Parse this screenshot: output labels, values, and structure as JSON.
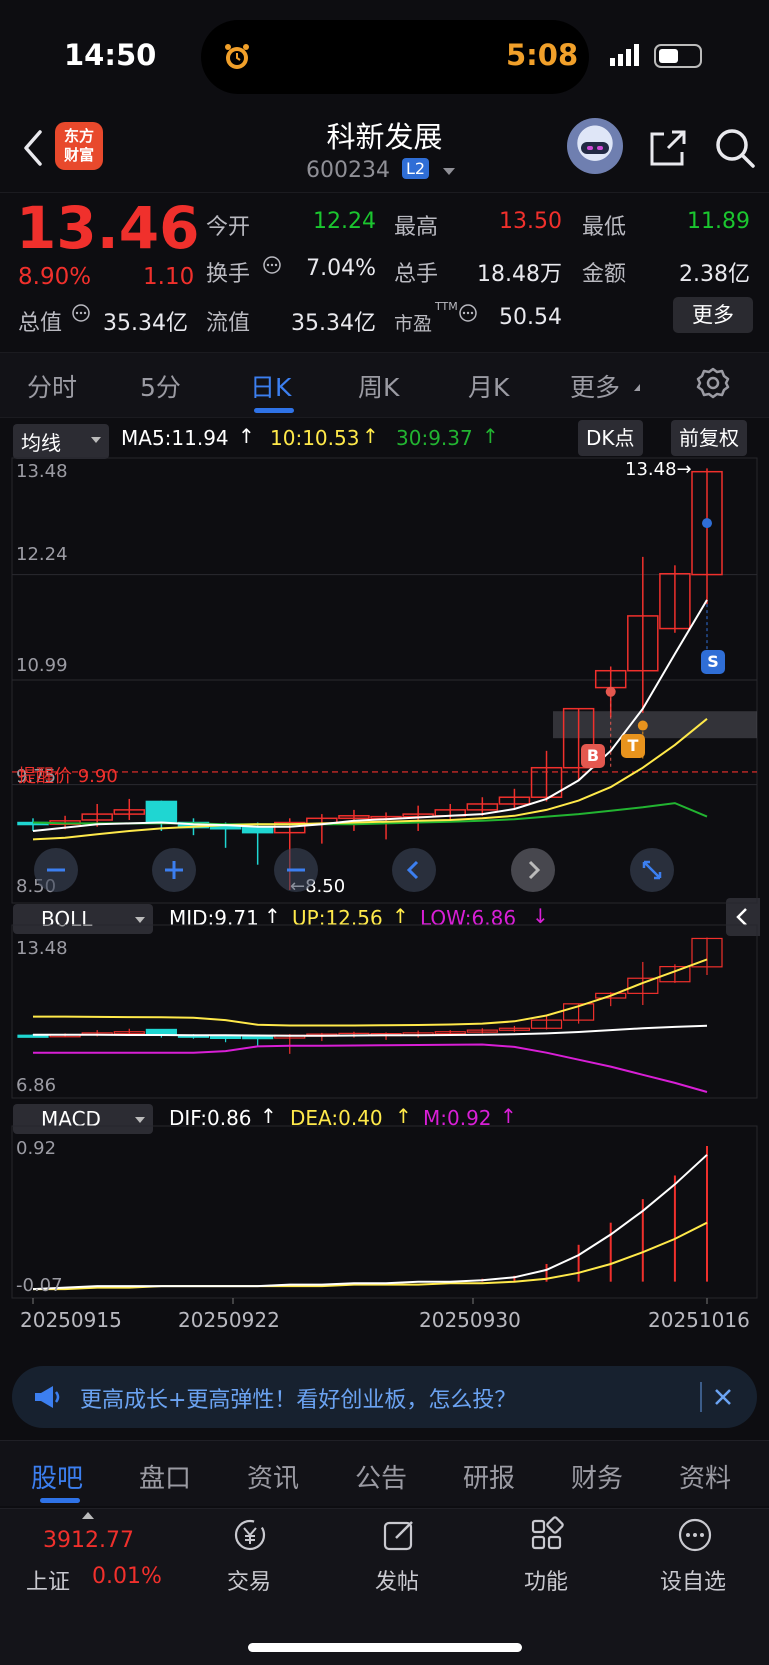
{
  "status_bar": {
    "time": "14:50",
    "timer": "5:08"
  },
  "header": {
    "logo_line1": "东方",
    "logo_line2": "财富",
    "title": "科新发展",
    "code": "600234",
    "level_badge": "L2"
  },
  "quote": {
    "price": "13.46",
    "change_pct": "8.90%",
    "change": "1.10",
    "open_label": "今开",
    "open": "12.24",
    "high_label": "最高",
    "high": "13.50",
    "low_label": "最低",
    "low": "11.89",
    "turnover_label": "换手",
    "turnover": "7.04%",
    "volume_label": "总手",
    "volume": "18.48万",
    "amount_label": "金额",
    "amount": "2.38亿",
    "mktcap_label": "总值",
    "mktcap": "35.34亿",
    "float_label": "流值",
    "float": "35.34亿",
    "pe_label": "市盈",
    "pe_sup": "TTM",
    "pe": "50.54",
    "more_button": "更多"
  },
  "tabs": [
    "分时",
    "5分",
    "日K",
    "周K",
    "月K",
    "更多"
  ],
  "active_tab": "日K",
  "main_panel": {
    "indicator": "均线",
    "ma5": "MA5:11.94",
    "ma10": "10:10.53",
    "ma30": "30:9.37",
    "dk_button": "DK点",
    "adjust_button": "前复权",
    "y_labels": [
      "13.48",
      "12.24",
      "10.99",
      "9.75",
      "8.50"
    ],
    "max_marker": "13.48→",
    "min_marker": "←8.50",
    "alert_line": "提醒价 9.90",
    "signal_b": "B",
    "signal_t": "T",
    "signal_s": "S"
  },
  "boll_panel": {
    "indicator": "BOLL",
    "mid": "MID:9.71",
    "up": "UP:12.56",
    "low": "LOW:6.86",
    "y_top": "13.48",
    "y_bottom": "6.86"
  },
  "macd_panel": {
    "indicator": "MACD",
    "dif": "DIF:0.86",
    "dea": "DEA:0.40",
    "m": "M:0.92",
    "y_top": "0.92",
    "y_bottom": "-0.07"
  },
  "dates": [
    "20250915",
    "20250922",
    "20250930",
    "20251016"
  ],
  "ad_banner": {
    "text": "更高成长+更高弹性！看好创业板，怎么投？"
  },
  "bottom_tabs": [
    "股吧",
    "盘口",
    "资讯",
    "公告",
    "研报",
    "财务",
    "资料"
  ],
  "dock": {
    "index_value": "3912.77",
    "index_name": "上证",
    "index_change": "0.01%",
    "trade": "交易",
    "post": "发帖",
    "function": "功能",
    "watchlist": "设自选"
  },
  "colors": {
    "up": "#f0302c",
    "down": "#1bc62f",
    "accent": "#3c7ff0",
    "ma5": "#ffffff",
    "ma10": "#ffe94a",
    "ma30": "#22b431",
    "boll_low": "#d81fd6"
  },
  "chart_data": {
    "type": "candlestick",
    "ylim": [
      8.5,
      13.48
    ],
    "candles": [
      {
        "o": 9.3,
        "c": 9.28,
        "h": 9.35,
        "l": 9.2
      },
      {
        "o": 9.28,
        "c": 9.32,
        "h": 9.38,
        "l": 9.22
      },
      {
        "o": 9.33,
        "c": 9.4,
        "h": 9.52,
        "l": 9.25
      },
      {
        "o": 9.4,
        "c": 9.45,
        "h": 9.58,
        "l": 9.33
      },
      {
        "o": 9.55,
        "c": 9.3,
        "h": 9.56,
        "l": 9.2
      },
      {
        "o": 9.3,
        "c": 9.24,
        "h": 9.35,
        "l": 9.15
      },
      {
        "o": 9.25,
        "c": 9.23,
        "h": 9.3,
        "l": 9.0
      },
      {
        "o": 9.24,
        "c": 9.18,
        "h": 9.3,
        "l": 8.8
      },
      {
        "o": 9.18,
        "c": 9.3,
        "h": 9.35,
        "l": 8.5
      },
      {
        "o": 9.28,
        "c": 9.35,
        "h": 9.4,
        "l": 9.05
      },
      {
        "o": 9.35,
        "c": 9.38,
        "h": 9.45,
        "l": 9.2
      },
      {
        "o": 9.36,
        "c": 9.37,
        "h": 9.42,
        "l": 9.1
      },
      {
        "o": 9.37,
        "c": 9.4,
        "h": 9.5,
        "l": 9.2
      },
      {
        "o": 9.38,
        "c": 9.45,
        "h": 9.52,
        "l": 9.3
      },
      {
        "o": 9.45,
        "c": 9.52,
        "h": 9.6,
        "l": 9.38
      },
      {
        "o": 9.52,
        "c": 9.6,
        "h": 9.7,
        "l": 9.45
      },
      {
        "o": 9.6,
        "c": 9.95,
        "h": 10.15,
        "l": 9.55
      },
      {
        "o": 9.95,
        "c": 10.65,
        "h": 10.65,
        "l": 9.8
      },
      {
        "o": 10.9,
        "c": 11.1,
        "h": 11.15,
        "l": 10.55
      },
      {
        "o": 11.1,
        "c": 11.75,
        "h": 12.45,
        "l": 10.6
      },
      {
        "o": 11.6,
        "c": 12.25,
        "h": 12.35,
        "l": 11.55
      },
      {
        "o": 12.24,
        "c": 13.46,
        "h": 13.5,
        "l": 11.89
      }
    ],
    "ma5": [
      9.2,
      9.24,
      9.28,
      9.29,
      9.3,
      9.28,
      9.27,
      9.25,
      9.25,
      9.28,
      9.32,
      9.34,
      9.36,
      9.38,
      9.4,
      9.46,
      9.58,
      9.8,
      10.15,
      10.65,
      11.3,
      11.94
    ],
    "ma10": [
      9.1,
      9.12,
      9.16,
      9.2,
      9.23,
      9.25,
      9.27,
      9.28,
      9.28,
      9.29,
      9.3,
      9.31,
      9.32,
      9.33,
      9.35,
      9.38,
      9.45,
      9.56,
      9.72,
      9.95,
      10.22,
      10.53
    ],
    "ma30": [
      9.3,
      9.29,
      9.29,
      9.29,
      9.29,
      9.29,
      9.28,
      9.28,
      9.28,
      9.28,
      9.28,
      9.29,
      9.3,
      9.31,
      9.32,
      9.34,
      9.37,
      9.4,
      9.44,
      9.48,
      9.53,
      9.37
    ],
    "boll": {
      "ylim": [
        6.86,
        13.48
      ],
      "mid": [
        9.32,
        9.32,
        9.32,
        9.31,
        9.31,
        9.3,
        9.3,
        9.29,
        9.28,
        9.28,
        9.29,
        9.3,
        9.3,
        9.31,
        9.32,
        9.34,
        9.38,
        9.44,
        9.52,
        9.6,
        9.66,
        9.71
      ],
      "up": [
        10.1,
        10.1,
        10.09,
        10.08,
        10.07,
        10.05,
        9.95,
        9.75,
        9.72,
        9.72,
        9.72,
        9.73,
        9.74,
        9.76,
        9.8,
        9.9,
        10.15,
        10.55,
        11.0,
        11.55,
        12.05,
        12.56
      ],
      "low": [
        8.55,
        8.55,
        8.55,
        8.55,
        8.55,
        8.55,
        8.62,
        8.82,
        8.85,
        8.85,
        8.86,
        8.87,
        8.88,
        8.89,
        8.9,
        8.8,
        8.55,
        8.25,
        7.95,
        7.6,
        7.25,
        6.86
      ]
    },
    "macd": {
      "ylim": [
        -0.07,
        0.92
      ],
      "dif": [
        -0.05,
        -0.04,
        -0.03,
        -0.03,
        -0.03,
        -0.03,
        -0.03,
        -0.03,
        -0.02,
        -0.02,
        -0.01,
        -0.01,
        0.0,
        0.0,
        0.01,
        0.03,
        0.08,
        0.18,
        0.32,
        0.48,
        0.66,
        0.86
      ],
      "dea": [
        -0.05,
        -0.05,
        -0.04,
        -0.04,
        -0.03,
        -0.03,
        -0.03,
        -0.03,
        -0.03,
        -0.03,
        -0.02,
        -0.02,
        -0.02,
        -0.01,
        -0.01,
        0.0,
        0.02,
        0.06,
        0.12,
        0.2,
        0.29,
        0.4
      ],
      "m": [
        0.0,
        0.0,
        0.0,
        0.0,
        0.0,
        0.0,
        0.0,
        0.0,
        0.0,
        0.0,
        0.0,
        0.0,
        0.0,
        0.0,
        0.02,
        0.04,
        0.12,
        0.25,
        0.4,
        0.56,
        0.72,
        0.92
      ]
    }
  }
}
